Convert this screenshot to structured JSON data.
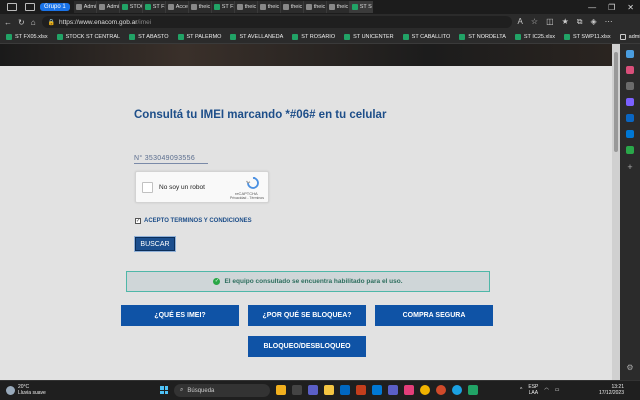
{
  "browser": {
    "tab_group_label": "Grupo 1",
    "tabs": [
      {
        "label": "Admi"
      },
      {
        "label": "Admi"
      },
      {
        "label": "STOC"
      },
      {
        "label": "ST FX"
      },
      {
        "label": "Acce"
      },
      {
        "label": "theic"
      },
      {
        "label": "ST FX"
      },
      {
        "label": "theic"
      },
      {
        "label": "theic"
      },
      {
        "label": "theic"
      },
      {
        "label": "theic"
      },
      {
        "label": "theic"
      },
      {
        "label": "ST St"
      }
    ],
    "url_prefix": "https://www.enacom.gob.ar",
    "url_path": "/imei",
    "bookmarks": [
      {
        "label": "ST FX05.xlsx"
      },
      {
        "label": "STOCK ST CENTRAL"
      },
      {
        "label": "ST ABASTO"
      },
      {
        "label": "ST PALERMO"
      },
      {
        "label": "ST AVELLANEDA"
      },
      {
        "label": "ST ROSARIO"
      },
      {
        "label": "ST UNICENTER"
      },
      {
        "label": "ST CABALLITO"
      },
      {
        "label": "ST NORDELTA"
      },
      {
        "label": "ST IC25.xlsx"
      },
      {
        "label": "ST SWP11.xlsx"
      },
      {
        "label": "admin"
      }
    ]
  },
  "page": {
    "heading": "Consultá tu IMEI marcando *#06# en tu celular",
    "imei_value": "N° 353049093556",
    "captcha": {
      "label": "No soy un robot",
      "brand": "reCAPTCHA",
      "terms": "Privacidad - Términos"
    },
    "terms_label": "ACEPTO TERMINOS Y CONDICIONES",
    "terms_checked": true,
    "search_button": "BUSCAR",
    "result_message": "El equipo consultado se encuentra habilitado para el uso.",
    "nav_buttons": {
      "que_es": "¿QUÉ ES IMEI?",
      "por_que": "¿POR QUÉ SE BLOQUEA?",
      "compra": "COMPRA SEGURA",
      "bloqueo": "BLOQUEO/DESBLOQUEO"
    },
    "colors": {
      "heading": "#1d4e89",
      "nav_button": "#0f53a6",
      "success": "#28a745"
    }
  },
  "taskbar": {
    "weather_temp": "20°C",
    "weather_desc": "Lluvia suave",
    "search_placeholder": "Búsqueda",
    "lang_top": "ESP",
    "lang_bottom": "LAA",
    "time": "13:21",
    "date": "17/12/2023"
  }
}
